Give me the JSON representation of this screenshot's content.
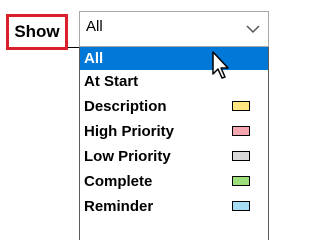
{
  "show_label": "Show",
  "combo": {
    "value": "All"
  },
  "dropdown": {
    "options": [
      {
        "label": "All",
        "selected": true,
        "swatch": null
      },
      {
        "label": "At Start",
        "selected": false,
        "swatch": null
      },
      {
        "label": "Description",
        "selected": false,
        "swatch": "#ffe680"
      },
      {
        "label": "High Priority",
        "selected": false,
        "swatch": "#f4a7b0"
      },
      {
        "label": "Low Priority",
        "selected": false,
        "swatch": "#d9d9d9"
      },
      {
        "label": "Complete",
        "selected": false,
        "swatch": "#9be07a"
      },
      {
        "label": "Reminder",
        "selected": false,
        "swatch": "#a7ddf2"
      }
    ]
  },
  "colors": {
    "highlight_border": "#d9202b",
    "selection": "#0078d7"
  }
}
